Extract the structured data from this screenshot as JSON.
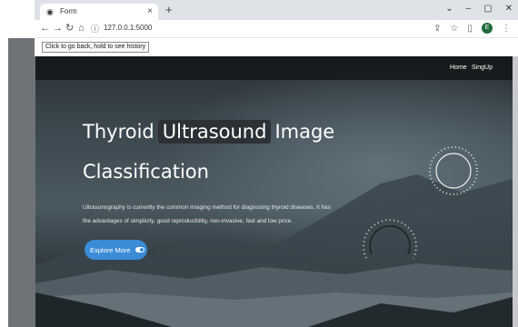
{
  "browser": {
    "tab_title": "Form",
    "tab_close": "×",
    "new_tab": "+",
    "window_controls": [
      "⌄",
      "–",
      "▢",
      "✕"
    ],
    "url": "127.0.0.1:5000",
    "tooltip": "Click to go back, hold to see history",
    "profile_initial": "E"
  },
  "navbar": {
    "items": [
      "Home",
      "SingUp"
    ]
  },
  "hero": {
    "title_word1": "Thyroid",
    "title_highlight": "Ultrasound",
    "title_word3": "Image",
    "title_line2": "Classification",
    "description_line1": "Ultrasonography is currently the common imaging method for diagnosing thyroid diseases. It has",
    "description_line2": "the advantages of simplicity, good reproducibility, non-invasive, fast and low price.",
    "cta_label": "Explore More"
  },
  "colors": {
    "accent": "#3b8bd6",
    "navbar_bg": "#141618"
  }
}
